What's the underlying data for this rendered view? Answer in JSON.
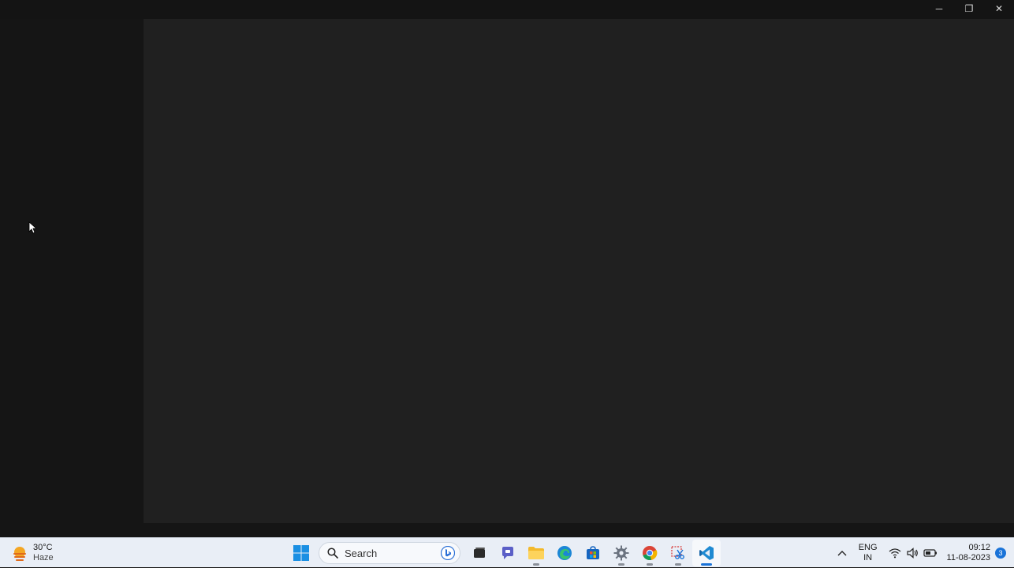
{
  "window": {
    "controls": {
      "minimize": "─",
      "restore": "❐",
      "close": "✕"
    }
  },
  "taskbar": {
    "weather": {
      "temperature": "30°C",
      "condition": "Haze",
      "icon": "sun-haze-icon"
    },
    "search": {
      "label": "Search"
    },
    "apps": [
      {
        "name": "start-menu",
        "icon": "windows-logo-icon"
      },
      {
        "name": "task-view",
        "icon": "task-view-icon"
      },
      {
        "name": "teams-chat",
        "icon": "chat-icon"
      },
      {
        "name": "file-explorer",
        "icon": "folder-icon"
      },
      {
        "name": "edge",
        "icon": "edge-icon"
      },
      {
        "name": "microsoft-store",
        "icon": "store-icon"
      },
      {
        "name": "settings",
        "icon": "gear-icon"
      },
      {
        "name": "chrome",
        "icon": "chrome-icon"
      },
      {
        "name": "snipping-tool",
        "icon": "scissors-icon"
      },
      {
        "name": "vscode",
        "icon": "vscode-icon"
      }
    ],
    "tray": {
      "language_line1": "ENG",
      "language_line2": "IN",
      "time": "09:12",
      "date": "11-08-2023",
      "notifications": "3"
    }
  },
  "colors": {
    "accent": "#1a73d8",
    "window_bg": "#151515",
    "content_bg": "#202020",
    "taskbar_bg": "#e9eef6"
  }
}
